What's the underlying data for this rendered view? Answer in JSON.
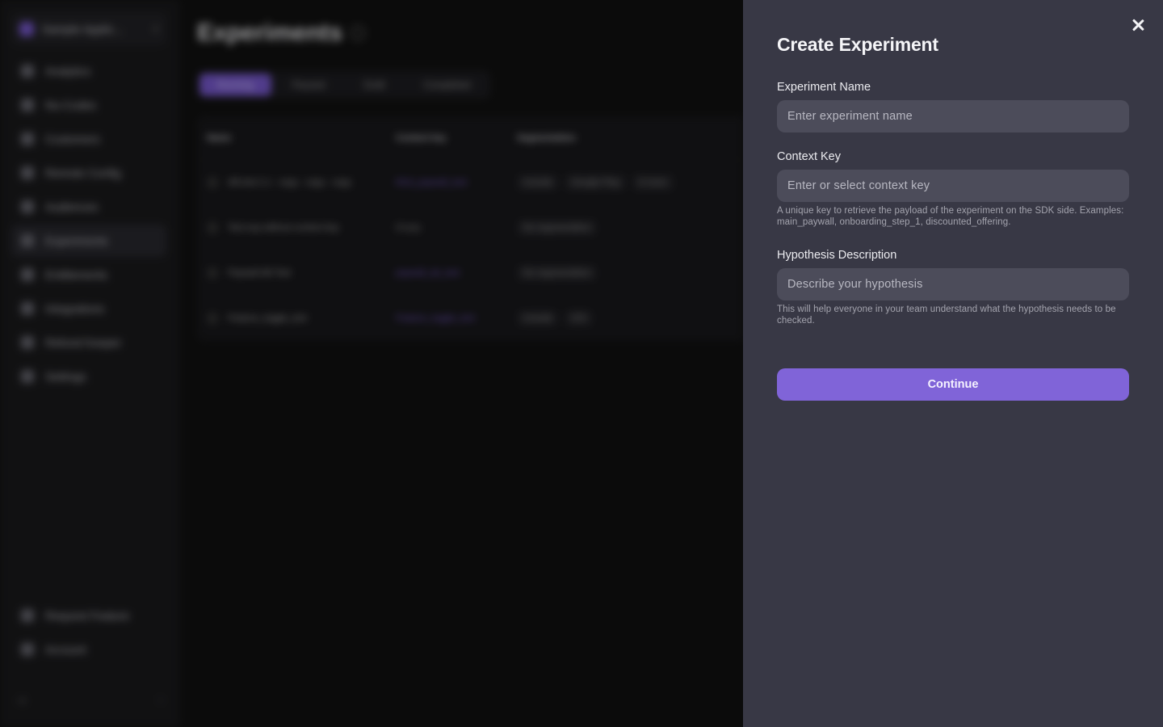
{
  "background": {
    "app_switcher": {
      "name": "Sample Applic..."
    },
    "nav": [
      {
        "label": "Analytics",
        "icon": "chart-icon"
      },
      {
        "label": "No-Codes",
        "icon": "layout-icon"
      },
      {
        "label": "Customers",
        "icon": "users-icon"
      },
      {
        "label": "Remote Config",
        "icon": "config-icon"
      },
      {
        "label": "Audiences",
        "icon": "target-icon"
      },
      {
        "label": "Experiments",
        "icon": "flask-icon",
        "active": true
      },
      {
        "label": "Entitlements",
        "icon": "key-icon"
      },
      {
        "label": "Integrations",
        "icon": "plug-icon"
      },
      {
        "label": "Refund Keeper",
        "icon": "refund-icon"
      },
      {
        "label": "Settings",
        "icon": "gear-icon"
      }
    ],
    "nav_bottom": [
      {
        "label": "Request Feature",
        "icon": "bulb-icon"
      },
      {
        "label": "Account",
        "icon": "user-icon"
      }
    ],
    "page_title": "Experiments",
    "tabs": [
      "Running",
      "Paused",
      "Draft",
      "Completed"
    ],
    "table": {
      "headers": [
        "Name",
        "Context key",
        "Segmentation"
      ],
      "rows": [
        {
          "name": "AB test 2.1 - copy - copy - copy",
          "key": "third_paywall_test",
          "seg": [
            "Include",
            "Google Play",
            "8 more"
          ]
        },
        {
          "name": "Test exp without context key",
          "key": "Empty",
          "seg": [
            "No segmentation"
          ]
        },
        {
          "name": "Paywall AB Test",
          "key": "paywall_ab_test",
          "seg": [
            "No segmentation"
          ]
        },
        {
          "name": "Feature_toggle_test",
          "key": "Feature_toggle_test",
          "seg": [
            "Include",
            "iOS"
          ]
        }
      ]
    }
  },
  "drawer": {
    "title": "Create Experiment",
    "name_label": "Experiment Name",
    "name_placeholder": "Enter experiment name",
    "key_label": "Context Key",
    "key_placeholder": "Enter or select context key",
    "key_help": "A unique key to retrieve the payload of the experiment on the SDK side. Examples: main_paywall, onboarding_step_1, discounted_offering.",
    "hyp_label": "Hypothesis Description",
    "hyp_placeholder": "Describe your hypothesis",
    "hyp_help": "This will help everyone in your team understand what the hypothesis needs to be checked.",
    "continue_label": "Continue"
  },
  "colors": {
    "accent": "#8064d8",
    "drawer_bg": "#383845",
    "input_bg": "#4c4c5a"
  }
}
